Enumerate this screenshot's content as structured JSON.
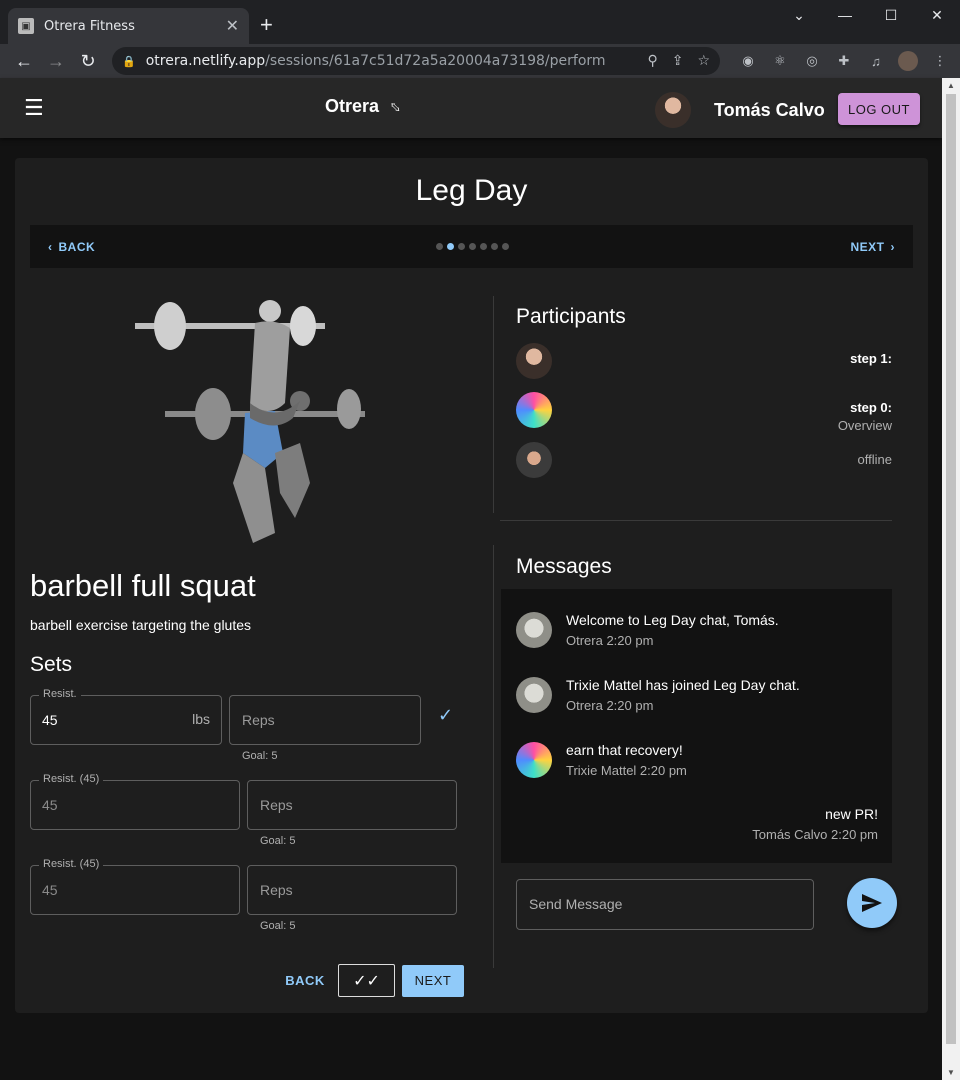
{
  "browser": {
    "tab_title": "Otrera Fitness",
    "tab_close": "✕",
    "new_tab": "+",
    "url_host": "otrera.netlify.app",
    "url_path": "/sessions/61a7c51d72a5a20004a73198/perform"
  },
  "appbar": {
    "brand": "Otrera",
    "user_name": "Tomás Calvo",
    "logout_label": "LOG OUT"
  },
  "session": {
    "title": "Leg Day",
    "back_label": "BACK",
    "next_label": "NEXT",
    "step_count": 7,
    "active_step": 1
  },
  "exercise": {
    "name": "barbell full squat",
    "description": "barbell exercise targeting the glutes",
    "sets_title": "Sets",
    "sets": [
      {
        "resist_label": "Resist.",
        "resist_value": "45",
        "unit": "lbs",
        "reps_placeholder": "Reps",
        "goal": "Goal: 5",
        "checked": true
      },
      {
        "resist_label": "Resist. (45)",
        "resist_value": "45",
        "reps_placeholder": "Reps",
        "goal": "Goal: 5"
      },
      {
        "resist_label": "Resist. (45)",
        "resist_value": "45",
        "reps_placeholder": "Reps",
        "goal": "Goal: 5"
      }
    ],
    "back_label": "BACK",
    "next_label": "NEXT"
  },
  "participants": {
    "title": "Participants",
    "items": [
      {
        "avatar": "tomas-avatar",
        "step": "step 1:",
        "sub": ""
      },
      {
        "avatar": "trixie-avatar",
        "step": "step 0:",
        "sub": "Overview"
      },
      {
        "avatar": "beard-avatar",
        "step": "",
        "sub": "offline"
      }
    ]
  },
  "messages": {
    "title": "Messages",
    "items": [
      {
        "text": "Welcome to Leg Day chat, Tomás.",
        "meta": "Otrera 2:20 pm"
      },
      {
        "text": "Trixie Mattel has joined Leg Day chat.",
        "meta": "Otrera 2:20 pm"
      },
      {
        "text": "earn that recovery!",
        "meta": "Trixie Mattel 2:20 pm"
      },
      {
        "text": "new PR!",
        "meta": "Tomás Calvo 2:20 pm"
      }
    ],
    "send_placeholder": "Send Message"
  },
  "colors": {
    "accent": "#90caf9",
    "logout": "#ce93d8",
    "card": "#1e1e1e",
    "background": "#121212"
  }
}
